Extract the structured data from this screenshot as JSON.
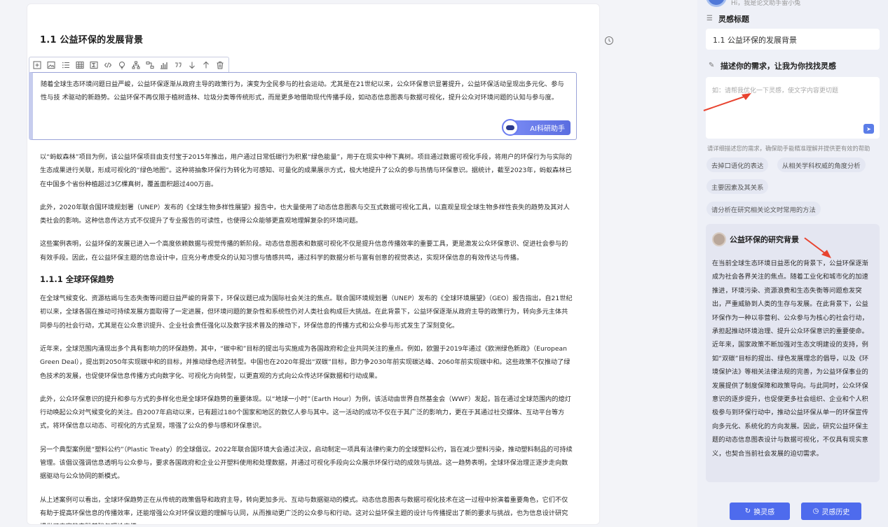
{
  "document": {
    "heading": "1.1 公益环保的发展背景",
    "toolbar_icons": [
      "add-block-icon",
      "image-icon",
      "list-icon",
      "table-icon",
      "formula-icon",
      "code-icon",
      "idea-icon",
      "hierarchy-icon",
      "flow-icon",
      "bar-chart-icon",
      "quote-icon",
      "move-down-icon",
      "move-up-icon",
      "delete-icon"
    ],
    "editing_paragraph": "随着全球生态环境问题日益严峻，公益环保逐渐从政府主导的政策行为，演变为全民参与的社会运动。尤其是在21世纪以来，公众环保意识显著提升，公益环保活动呈现出多元化、参与性与技 术驱动的新趋势。公益环保不再仅限于植树造林、垃圾分类等传统形式，而是更多地借助现代传播手段，如动态信息图表与数据可视化，提升公众对环境问题的认知与参与度。",
    "ai_button": "AI科研助手",
    "paragraphs": [
      "以“蚂蚁森林”项目为例，该公益环保项目由支付宝于2015年推出，用户通过日常低碳行为积累“绿色能量”，用于在现实中种下真树。项目通过数据可视化手段，将用户的环保行为与实际的生态成果进行关联，形成可视化的“绿色地图”。这种将抽象环保行为转化为可感知、可量化的成果展示方式，极大地提升了公众的参与热情与环保意识。据统计，截至2023年，蚂蚁森林已在中国多个省份种植超过3亿棵真树，覆盖面积超过400万亩。",
      "此外，2020年联合国环境规划署（UNEP）发布的《全球生物多样性展望》报告中，也大量使用了动态信息图表与交互式数据可视化工具，以直观呈现全球生物多样性丧失的趋势及其对人类社会的影响。这种信息传达方式不仅提升了专业报告的可读性，也使得公众能够更直观地理解复杂的环境问题。",
      "这些案例表明，公益环保的发展已进入一个高度依赖数据与视觉传播的新阶段。动态信息图表和数据可视化不仅是提升信息传播效率的重要工具，更是激发公众环保意识、促进社会参与的有效手段。因此，在公益环保主题的信息设计中，应充分考虑受众的认知习惯与情感共鸣，通过科学的数据分析与富有创意的视觉表达，实现环保信息的有效传达与传播。"
    ],
    "subheading": "1.1.1 全球环保趋势",
    "sub_paragraphs": [
      "在全球气候变化、资源枯竭与生态失衡等问题日益严峻的背景下，环保议题已成为国际社会关注的焦点。联合国环境规划署（UNEP）发布的《全球环境展望》（GEO）报告指出，自21世纪初以来，全球各国在推动可持续发展方面取得了一定进展，但环境问题的复杂性和系统性仍对人类社会构成巨大挑战。在此背景下，公益环保逐渐从政府主导的政策行为，转向多元主体共同参与的社会行动，尤其是在公众意识提升、企业社会责任强化以及数字技术普及的推动下，环保信息的传播方式和公众参与形式发生了深刻变化。",
      "近年来，全球范围内涌现出多个具有影响力的环保趋势。其中，“碳中和”目标的提出与实施成为各国政府和企业共同关注的重点。例如，欧盟于2019年通过《欧洲绿色新政》（European Green Deal），提出到2050年实现碳中和的目标，并推动绿色经济转型。中国也在2020年提出“双碳”目标，即力争2030年前实现碳达峰、2060年前实现碳中和。这些政策不仅推动了绿色技术的发展，也促使环保信息传播方式向数字化、可视化方向转型，以更直观的方式向公众传达环保数据和行动成果。",
      "此外，公众环保意识的提升和参与方式的多样化也是全球环保趋势的重要体现。以“地球一小时”（Earth Hour）为例，该活动由世界自然基金会（WWF）发起，旨在通过全球范围内的熄灯行动唤起公众对气候变化的关注。自2007年启动以来，已有超过180个国家和地区的数亿人参与其中。这一活动的成功不仅在于其广泛的影响力，更在于其通过社交媒体、互动平台等方式，将环保信息以动态、可视化的方式呈现，增强了公众的参与感和环保意识。",
      "另一个典型案例是“塑料公约”（Plastic Treaty）的全球倡议。2022年联合国环境大会通过决议，启动制定一项具有法律约束力的全球塑料公约，旨在减少塑料污染，推动塑料制品的可持续管理。该倡议强调信息透明与公众参与，要求各国政府和企业公开塑料使用和处理数据，并通过可视化手段向公众展示环保行动的成效与挑战。这一趋势表明，全球环保治理正逐步走向数据驱动与公众协同的新模式。",
      "从上述案例可以看出，全球环保趋势正在从传统的政策倡导和政府主导，转向更加多元、互动与数据驱动的模式。动态信息图表与数据可视化技术在这一过程中扮演着重要角色，它们不仅有助于提高环保信息的传播效率，还能增强公众对环保议题的理解与认同，从而推动更广泛的公众参与和行动。这对公益环保主题的设计与传播提出了新的要求与挑战，也为信息设计研究提供了丰富的实践基础与理论支撑。"
    ]
  },
  "panel": {
    "greeting": "Hi，我是论文助手雷小兔",
    "inspiration_title_label": "灵感标题",
    "inspiration_title_value": "1.1 公益环保的发展背景",
    "describe_label": "描述你的需求，让我为你找找灵感",
    "describe_placeholder": "如：请帮我优化一下灵感，使文字内容更切题",
    "hint": "请详细描述您的需求，确保助手能精准理解并提供更有效的帮助",
    "chips": [
      "去掉口语化的表达",
      "从相关学科权威的角度分析",
      "主要因素及其关系",
      "请分析在研究相关论文时常用的方法"
    ],
    "card_title": "公益环保的研究背景",
    "card_body": "在当前全球生态环境日益恶化的背景下，公益环保逐渐成为社会各界关注的焦点。随着工业化和城市化的加速推进，环境污染、资源浪费和生态失衡等问题愈发突出，严重威胁到人类的生存与发展。在此背景下，公益环保作为一种以非营利、公众参与为核心的社会行动，承担起推动环境治理、提升公众环保意识的重要使命。近年来，国家政策不断加强对生态文明建设的支持，例如“双碳”目标的提出、绿色发展理念的倡导，以及《环境保护法》等相关法律法规的完善，为公益环保事业的发展提供了制度保障和政策导向。与此同时，公众环保意识的逐步提升，也促使更多社会组织、企业和个人积极参与到环保行动中，推动公益环保从单一的环保宣传向多元化、系统化的方向发展。因此，研究公益环保主题的动态信息图表设计与数据可视化，不仅具有现实意义，也契合当前社会发展的迫切需求。",
    "btn_refresh": "换灵感",
    "btn_history": "灵感历史"
  },
  "colors": {
    "accent": "#4e6bed",
    "annotation_arrow": "#e8432f"
  }
}
